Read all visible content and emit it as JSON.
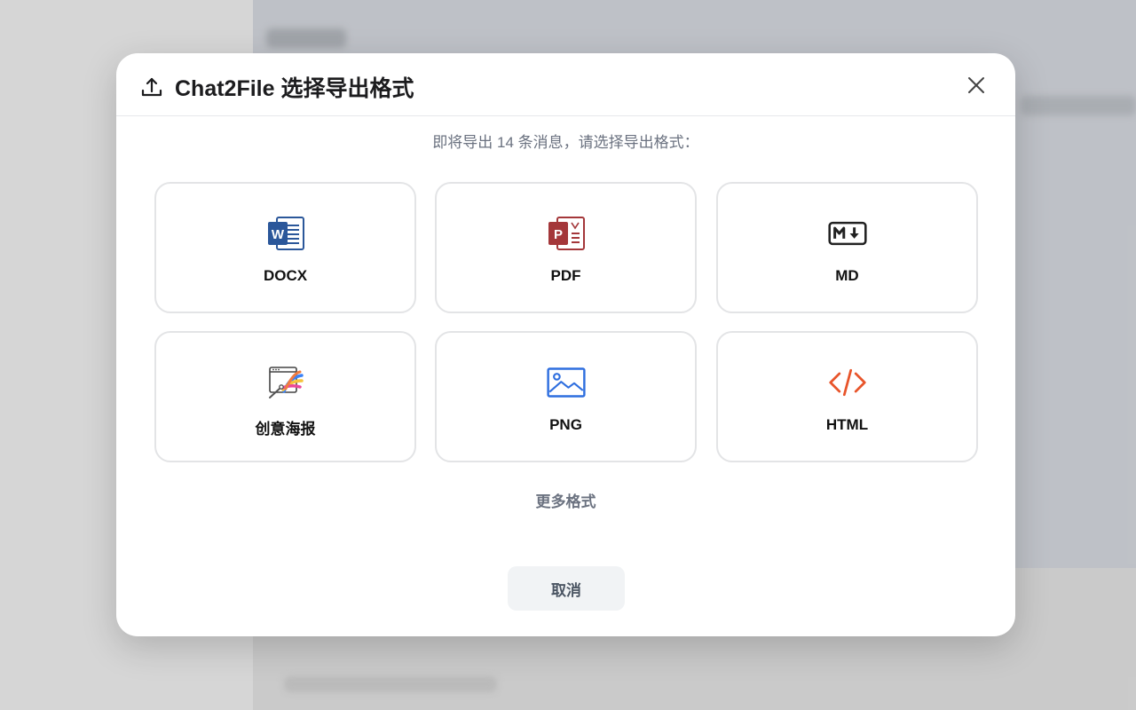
{
  "modal": {
    "title": "Chat2File 选择导出格式",
    "header_icon": "upload-icon",
    "close_icon": "close-icon",
    "subtitle": "即将导出 14 条消息，请选择导出格式：",
    "formats": [
      {
        "label": "DOCX",
        "icon": "word-doc-icon",
        "color": "#2b579a"
      },
      {
        "label": "PDF",
        "icon": "pdf-doc-icon",
        "color": "#a4373a"
      },
      {
        "label": "MD",
        "icon": "markdown-icon",
        "color": "#222222"
      },
      {
        "label": "创意海报",
        "icon": "poster-palette-icon",
        "color": "#f07b3f"
      },
      {
        "label": "PNG",
        "icon": "image-icon",
        "color": "#2f6fdf"
      },
      {
        "label": "HTML",
        "icon": "code-icon",
        "color": "#e8542a"
      }
    ],
    "more_label": "更多格式",
    "cancel_label": "取消"
  }
}
